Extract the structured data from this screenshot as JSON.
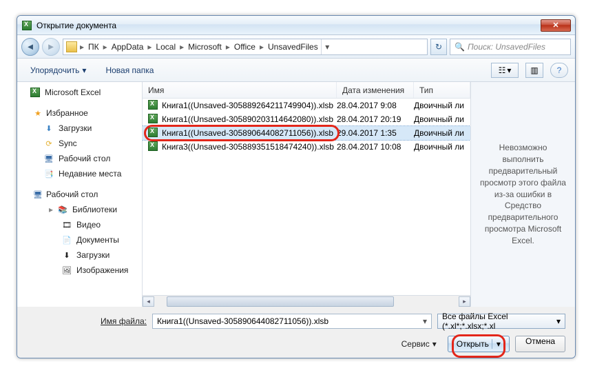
{
  "title": "Открытие документа",
  "breadcrumb": [
    "ПК",
    "AppData",
    "Local",
    "Microsoft",
    "Office",
    "UnsavedFiles"
  ],
  "search_placeholder": "Поиск: UnsavedFiles",
  "toolbar": {
    "organize": "Упорядочить",
    "newfolder": "Новая папка"
  },
  "sidebar": {
    "microsoft_excel": "Microsoft Excel",
    "favorites": "Избранное",
    "fav_items": [
      "Загрузки",
      "Sync",
      "Рабочий стол",
      "Недавние места"
    ],
    "desktop": "Рабочий стол",
    "libraries": "Библиотеки",
    "lib_items": [
      "Видео",
      "Документы",
      "Загрузки",
      "Изображения"
    ]
  },
  "columns": {
    "name": "Имя",
    "modified": "Дата изменения",
    "type": "Тип"
  },
  "files": [
    {
      "name": "Книга1((Unsaved-305889264211749904)).xlsb",
      "date": "28.04.2017 9:08",
      "type": "Двоичный ли"
    },
    {
      "name": "Книга1((Unsaved-305890203114642080)).xlsb",
      "date": "28.04.2017 20:19",
      "type": "Двоичный ли"
    },
    {
      "name": "Книга1((Unsaved-305890644082711056)).xlsb",
      "date": "29.04.2017 1:35",
      "type": "Двоичный ли"
    },
    {
      "name": "Книга3((Unsaved-305889351518474240)).xlsb",
      "date": "28.04.2017 10:08",
      "type": "Двоичный ли"
    }
  ],
  "selected_index": 2,
  "preview_text": "Невозможно выполнить предварительный просмотр этого файла из-за ошибки в Средство предварительного просмотра Microsoft Excel.",
  "filename_label": "Имя файла:",
  "filename_value": "Книга1((Unsaved-305890644082711056)).xlsb",
  "filter": "Все файлы Excel (*.xl*;*.xlsx;*.xl",
  "service": "Сервис",
  "open": "Открыть",
  "cancel": "Отмена"
}
